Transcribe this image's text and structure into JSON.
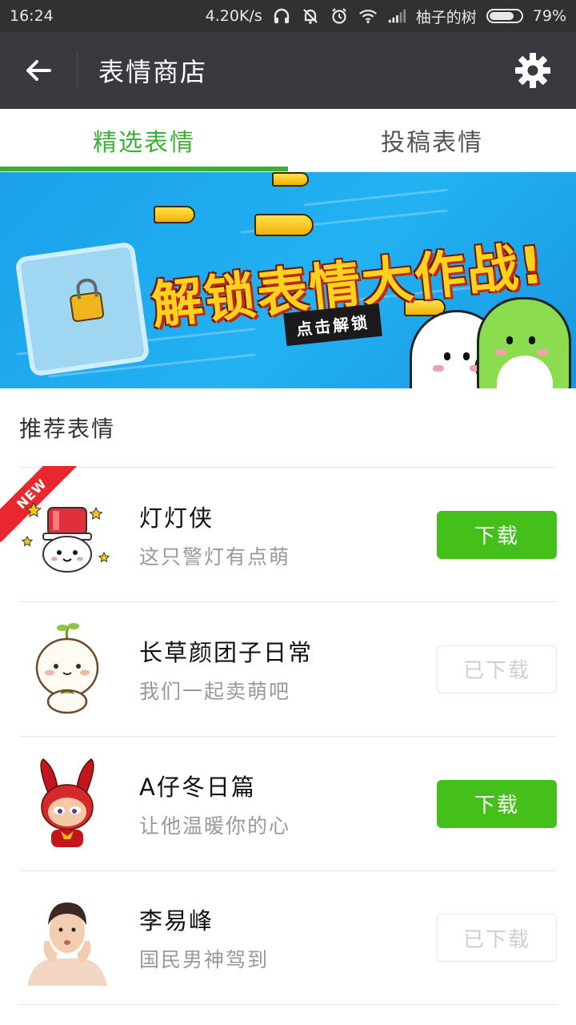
{
  "status_bar": {
    "time": "16:24",
    "speed": "4.20K/s",
    "carrier": "柚子的树",
    "battery": "79%",
    "battery_level": 0.79
  },
  "app_bar": {
    "title": "表情商店",
    "back_icon": "arrow-left-icon",
    "settings_icon": "gear-icon"
  },
  "tabs": [
    {
      "label": "精选表情",
      "active": true
    },
    {
      "label": "投稿表情",
      "active": false
    }
  ],
  "banner": {
    "title": "解锁表情大作战!",
    "cta": "点击解锁"
  },
  "section": {
    "title": "推荐表情"
  },
  "items": [
    {
      "name": "灯灯侠",
      "desc": "这只警灯有点萌",
      "button": "下载",
      "state": "download",
      "badge": "NEW"
    },
    {
      "name": "长草颜团子日常",
      "desc": "我们一起卖萌吧",
      "button": "已下载",
      "state": "done"
    },
    {
      "name": "A仔冬日篇",
      "desc": "让他温暖你的心",
      "button": "下载",
      "state": "download"
    },
    {
      "name": "李易峰",
      "desc": "国民男神驾到",
      "button": "已下载",
      "state": "done"
    }
  ],
  "colors": {
    "accent_green": "#3cb034",
    "button_green": "#45c01a",
    "appbar": "#393a3f",
    "statusbar": "#2f3133"
  }
}
